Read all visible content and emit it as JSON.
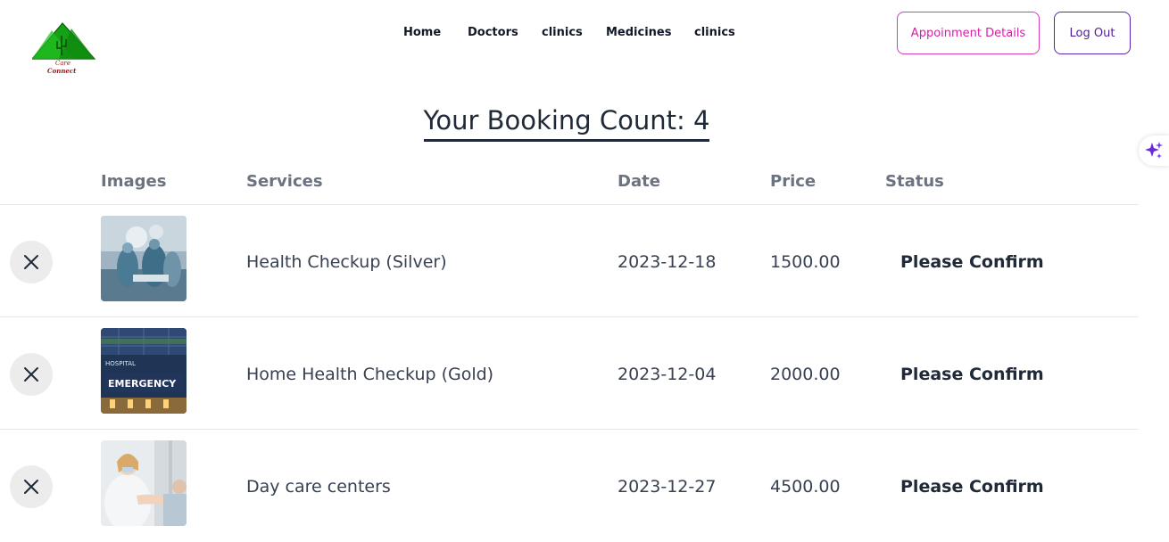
{
  "logo": {
    "text_line1": "Care",
    "text_line2": "Connect"
  },
  "nav": {
    "links": [
      "Home",
      "Doctors",
      "clinics",
      "Medicines",
      "clinics"
    ]
  },
  "header_buttons": {
    "appointment_label": "Appoinment Details",
    "logout_label": "Log Out"
  },
  "heading": "Your Booking Count: 4",
  "table": {
    "columns": [
      "Images",
      "Services",
      "Date",
      "Price",
      "Status"
    ],
    "rows": [
      {
        "service": "Health Checkup (Silver)",
        "date": "2023-12-18",
        "price": "1500.00",
        "status": "Please Confirm",
        "image": "surgery-photo"
      },
      {
        "service": "Home Health Checkup (Gold)",
        "date": "2023-12-04",
        "price": "2000.00",
        "status": "Please Confirm",
        "image": "hospital-emergency-photo",
        "image_text": "EMERGENCY",
        "image_text2": "HOSPITAL"
      },
      {
        "service": "Day care centers",
        "date": "2023-12-27",
        "price": "4500.00",
        "status": "Please Confirm",
        "image": "doctor-patient-photo"
      }
    ]
  },
  "colors": {
    "accent_pink": "#d61fa5",
    "accent_purple": "#5b21b6",
    "logo_green": "#15a015",
    "logo_text": "#8b1a1a"
  },
  "icons": {
    "delete": "close-icon",
    "assistant": "sparkle-icon"
  }
}
